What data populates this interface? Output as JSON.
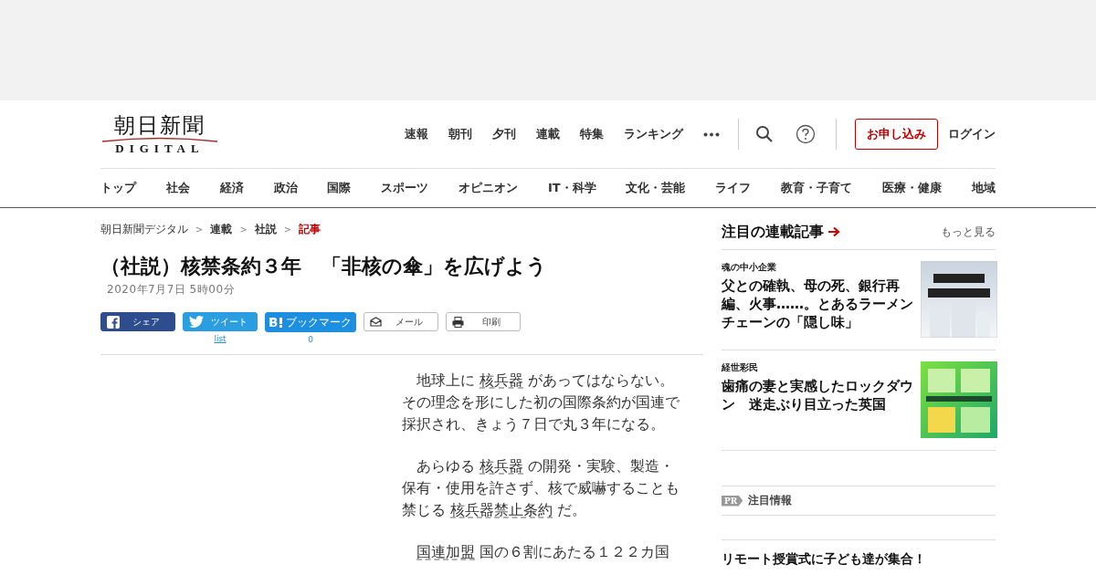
{
  "logo": {
    "title": "朝日新聞",
    "subtitle": "DIGITAL"
  },
  "top_nav": [
    "速報",
    "朝刊",
    "夕刊",
    "連載",
    "特集",
    "ランキング"
  ],
  "header_actions": {
    "subscribe": "お申し込み",
    "login": "ログイン"
  },
  "categories": [
    "トップ",
    "社会",
    "経済",
    "政治",
    "国際",
    "スポーツ",
    "オピニオン",
    "IT・科学",
    "文化・芸能",
    "ライフ",
    "教育・子育て",
    "医療・健康",
    "地域"
  ],
  "breadcrumb": [
    {
      "label": "朝日新聞デジタル",
      "selected": false
    },
    {
      "separator": ">",
      "label": "連載",
      "selected": false
    },
    {
      "separator": ">",
      "label": "社説",
      "selected": false
    },
    {
      "separator": ">",
      "label": "記事",
      "selected": true
    }
  ],
  "article": {
    "title": "（社説）核禁条約３年　「非核の傘」を広げよう",
    "date": "2020年7月7日 5時00分",
    "share": [
      {
        "kind": "facebook",
        "label": "シェア"
      },
      {
        "kind": "twitter",
        "label": "ツイート",
        "count": "list"
      },
      {
        "kind": "hatena",
        "label": "ブックマーク",
        "count": "0"
      },
      {
        "kind": "mail",
        "label": "メール"
      },
      {
        "kind": "print",
        "label": "印刷"
      }
    ],
    "paragraphs": [
      [
        {
          "kind": "text",
          "text": "地球上に "
        },
        {
          "kind": "link",
          "text": "核兵器"
        },
        {
          "kind": "text",
          "text": " があってはならない。その理念を形にした初の国際条約が国連で採択され、きょう７日で丸３年になる。"
        }
      ],
      [
        {
          "kind": "text",
          "text": "あらゆる "
        },
        {
          "kind": "link",
          "text": "核兵器"
        },
        {
          "kind": "text",
          "text": " の開発・実験、製造・保有・使用を許さず、核で威嚇することも禁じる "
        },
        {
          "kind": "link",
          "text": "核兵器禁止条約"
        },
        {
          "kind": "text",
          "text": " だ。"
        }
      ],
      [
        {
          "kind": "link",
          "text": "国連加盟"
        },
        {
          "kind": "text",
          "text": " 国の６割にあたる１２２カ国"
        }
      ]
    ]
  },
  "sidebar": {
    "heading": "注目の連載記事",
    "more": "もっと見る",
    "items": [
      {
        "series": "魂の中小企業",
        "title": "父との確執、母の死、銀行再編、火事……。とあるラーメンチェーンの「隠し味」",
        "kind": "picture"
      },
      {
        "series": "経世彩民",
        "title": "歯痛の妻と実感したロックダウン　迷走ぶり目立った英国",
        "kind": "picture"
      }
    ],
    "pr": {
      "badge": "PR",
      "label": "注目情報"
    },
    "pr_items": [
      {
        "title": "リモート授賞式に子ども達が集合！"
      }
    ]
  }
}
